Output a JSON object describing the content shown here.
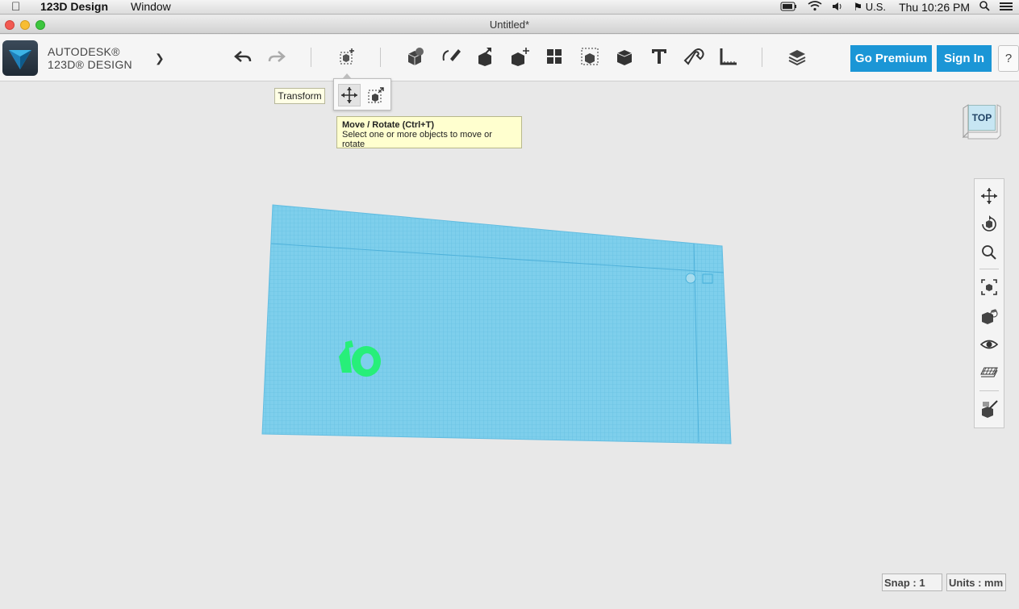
{
  "menubar": {
    "app_name": "123D Design",
    "menus": [
      "Window"
    ],
    "input_source": "U.S.",
    "clock": "Thu 10:26 PM"
  },
  "window": {
    "title": "Untitled*"
  },
  "brand": {
    "line1": "AUTODESK®",
    "line2": "123D® DESIGN"
  },
  "toolbar": {
    "tools": [
      "undo",
      "redo",
      "transform",
      "primitives",
      "sketch",
      "construct",
      "modify",
      "pattern",
      "grouping",
      "combine",
      "text",
      "snap",
      "measure",
      "materials"
    ],
    "premium_label": "Go Premium",
    "signin_label": "Sign In",
    "help_label": "?"
  },
  "transform_menu": {
    "label": "Transform",
    "items": [
      "move-rotate",
      "scale"
    ],
    "tooltip_title": "Move / Rotate (Ctrl+T)",
    "tooltip_desc": "Select one or more objects to move or rotate"
  },
  "viewcube": {
    "face": "TOP"
  },
  "navbar": {
    "items": [
      "pan",
      "orbit",
      "zoom",
      "fit",
      "views",
      "visibility",
      "grid-material",
      "material"
    ]
  },
  "status": {
    "snap_label": "Snap : 1",
    "units_label": "Units : mm"
  },
  "colors": {
    "accent": "#1b96d6",
    "grid": "#74c9e6",
    "object": "#2af07a"
  }
}
